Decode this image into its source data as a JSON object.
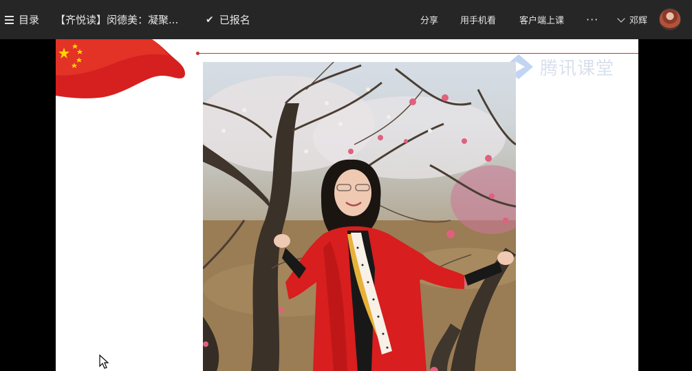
{
  "topbar": {
    "menu_label": "目录",
    "course_title": "【齐悦读】闵德美：凝聚...",
    "enrolled_label": "已报名",
    "share_label": "分享",
    "mobile_label": "用手机看",
    "client_label": "客户端上课",
    "more_label": "···",
    "user_name": "邓辉"
  },
  "slide": {
    "watermark_text": "腾讯课堂"
  },
  "colors": {
    "topbar_bg": "#262626",
    "slide_bg": "#ffffff",
    "accent_red": "#c0392b",
    "coat_red": "#d81e1e"
  },
  "icons": [
    "hamburger-icon",
    "check-icon",
    "chevron-down-icon",
    "tencent-classroom-logo-icon",
    "china-flag-icon",
    "mouse-cursor-icon"
  ]
}
